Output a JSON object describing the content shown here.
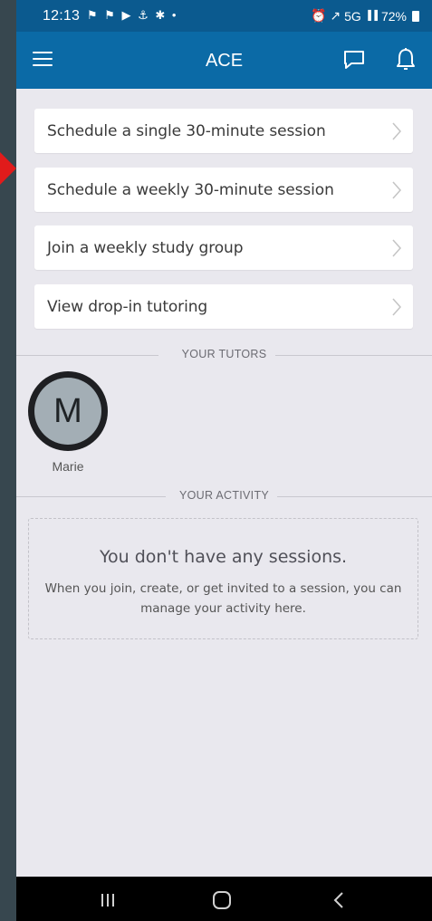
{
  "status_bar": {
    "time": "12:13",
    "left_icons": "⚑ ⚑ ▶ ⚓ ✱ •",
    "right_text": "5G",
    "battery": "72%"
  },
  "app_bar": {
    "title": "ACE",
    "menu_icon": "hamburger-menu",
    "chat_icon": "chat-bubble",
    "bell_icon": "notification-bell"
  },
  "actions": [
    {
      "label": "Schedule a single 30-minute session"
    },
    {
      "label": "Schedule a weekly 30-minute session"
    },
    {
      "label": "Join a weekly study group"
    },
    {
      "label": "View drop-in tutoring"
    }
  ],
  "tutors_section": {
    "header": "YOUR TUTORS",
    "tutors": [
      {
        "initial": "M",
        "name": "Marie"
      }
    ]
  },
  "activity_section": {
    "header": "YOUR ACTIVITY",
    "empty_title": "You don't have any sessions.",
    "empty_desc": "When you join, create, or get invited to a session, you can manage your activity here."
  },
  "colors": {
    "status_bar": "#0b5a8f",
    "app_bar": "#0b6aa6",
    "background": "#e9e8ee",
    "annotation_arrow": "#e11b1b"
  }
}
